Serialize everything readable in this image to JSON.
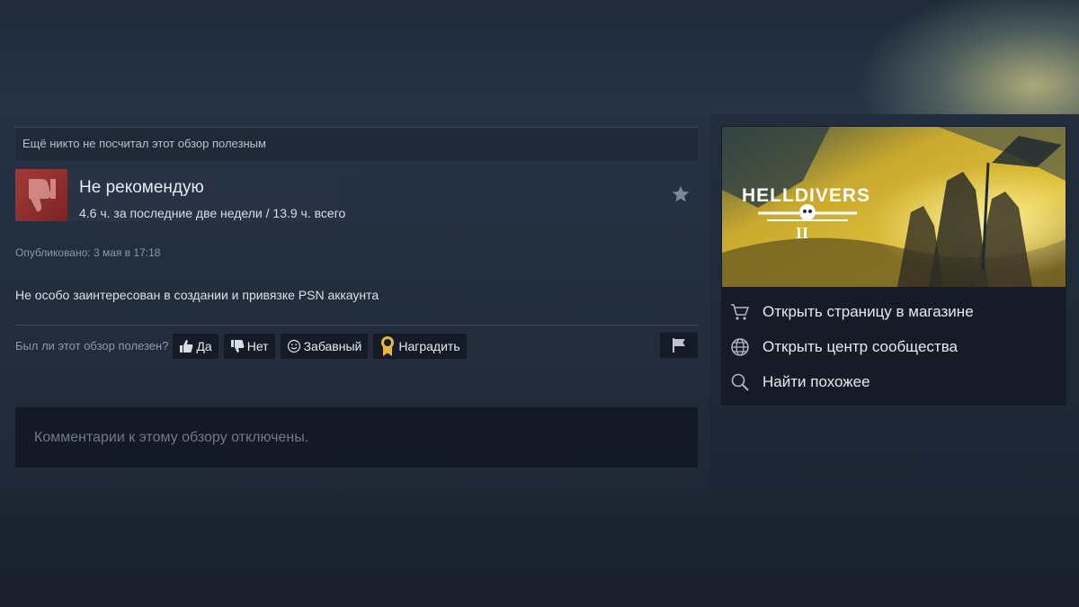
{
  "review": {
    "helpful_status": "Ещё никто не посчитал этот обзор полезным",
    "verdict": "Не рекомендую",
    "hours": "4.6 ч. за последние две недели / 13.9 ч. всего",
    "posted": "Опубликовано: 3 мая в 17:18",
    "text": "Не особо заинтересован в создании и привязке PSN аккаунта",
    "vote_question": "Был ли этот обзор полезен?",
    "buttons": {
      "yes": "Да",
      "no": "Нет",
      "funny": "Забавный",
      "award": "Наградить"
    },
    "comments_disabled": "Комментарии к этому обзору отключены."
  },
  "sidebar": {
    "game_logo": "HELLDIVERS",
    "game_logo_numeral": "II",
    "links": [
      {
        "label": "Открыть страницу в магазине",
        "icon": "cart-icon"
      },
      {
        "label": "Открыть центр сообщества",
        "icon": "globe-icon"
      },
      {
        "label": "Найти похожее",
        "icon": "search-icon"
      }
    ]
  },
  "colors": {
    "thumb_down_bg": "#a33b3b",
    "award_icon": "#e9b53c",
    "capsule_yellow": "#d7b531"
  }
}
